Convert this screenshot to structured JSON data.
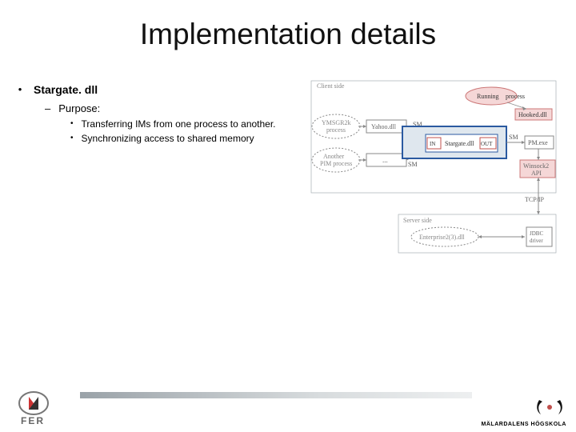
{
  "title": "Implementation details",
  "bullets": {
    "l1": "Stargate. dll",
    "l2": "Purpose:",
    "l3a": "Transferring IMs from one process to another.",
    "l3b": "Synchronizing access to shared memory"
  },
  "diagram": {
    "client_side": "Client side",
    "running": "Running",
    "process": "process",
    "hooked_dll": "Hooked.dll",
    "ymsg": "YMSGR2k",
    "ymsg2": "process",
    "yahoo_dll": "Yahoo.dll",
    "another": "Another",
    "another2": "PIM process",
    "sm": "SM",
    "stargate": "Stargate.dll",
    "in": "IN",
    "out": "OUT",
    "pm_exe": "PM.exe",
    "winsock": "Winsock2",
    "api": "API",
    "tcpip": "TCP/IP",
    "server_side": "Server side",
    "enterprise": "Enterprise2(3).dll",
    "jdbc": "JDBC",
    "driver": "driver"
  },
  "footer": {
    "fer": "FER",
    "mdh": "MÄLARDALENS HÖGSKOLA"
  },
  "colors": {
    "accent": "#c0504d",
    "faint": "#9aa2a8"
  }
}
